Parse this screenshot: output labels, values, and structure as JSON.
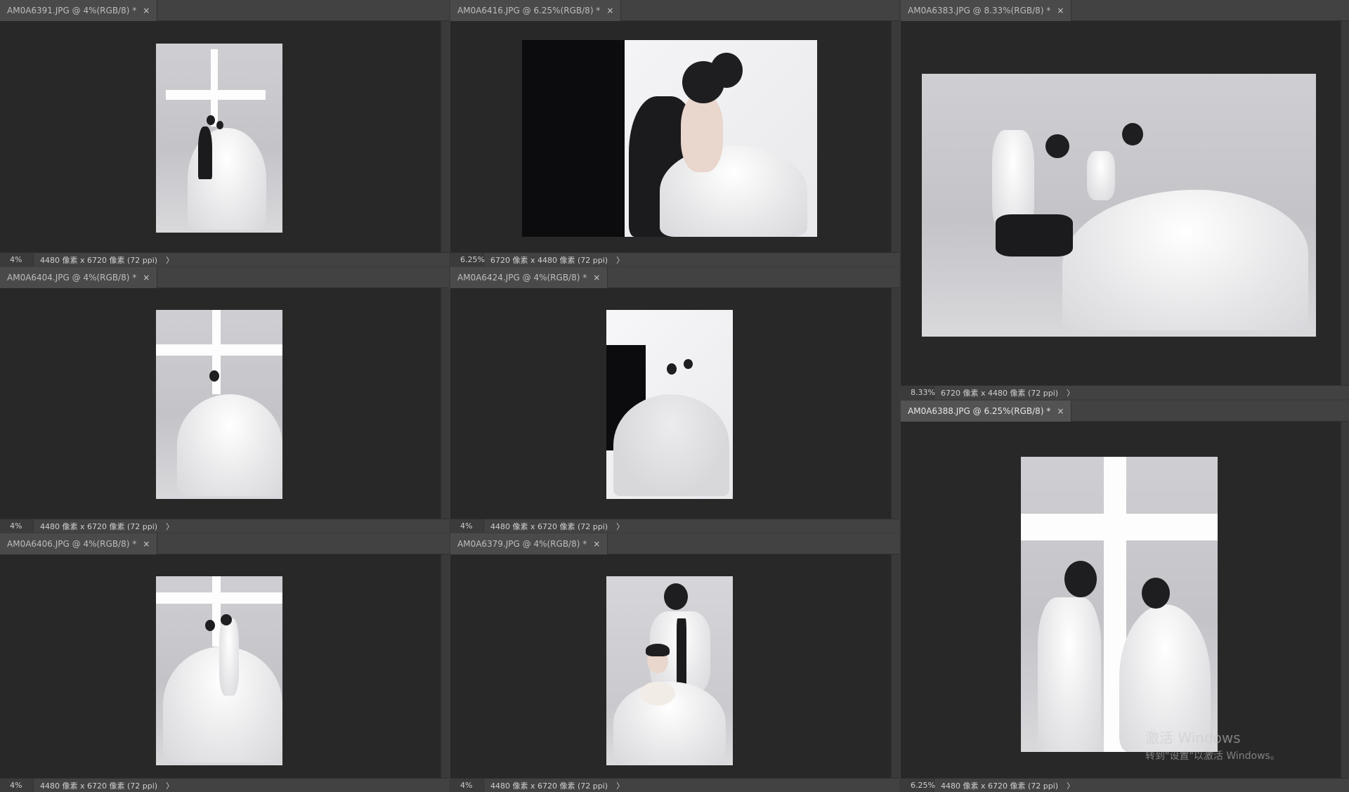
{
  "documents": [
    {
      "tab_label": "AM0A6391.JPG @ 4%(RGB/8) *",
      "zoom": "4%",
      "info": "4480 像素 x 6720 像素 (72 ppi)"
    },
    {
      "tab_label": "AM0A6416.JPG @ 6.25%(RGB/8) *",
      "zoom": "6.25%",
      "info": "6720 像素 x 4480 像素 (72 ppi)"
    },
    {
      "tab_label": "AM0A6383.JPG @ 8.33%(RGB/8) *",
      "zoom": "8.33%",
      "info": "6720 像素 x 4480 像素 (72 ppi)"
    },
    {
      "tab_label": "AM0A6404.JPG @ 4%(RGB/8) *",
      "zoom": "4%",
      "info": "4480 像素 x 6720 像素 (72 ppi)"
    },
    {
      "tab_label": "AM0A6424.JPG @ 4%(RGB/8) *",
      "zoom": "4%",
      "info": "4480 像素 x 6720 像素 (72 ppi)"
    },
    {
      "tab_label": "AM0A6388.JPG @ 6.25%(RGB/8) *",
      "zoom": "6.25%",
      "info": "4480 像素 x 6720 像素 (72 ppi)"
    },
    {
      "tab_label": "AM0A6406.JPG @ 4%(RGB/8) *",
      "zoom": "4%",
      "info": "4480 像素 x 6720 像素 (72 ppi)"
    },
    {
      "tab_label": "AM0A6379.JPG @ 4%(RGB/8) *",
      "zoom": "4%",
      "info": "4480 像素 x 6720 像素 (72 ppi)"
    }
  ],
  "icons": {
    "tab_close": "×",
    "status_arrow": "〉"
  },
  "watermark": {
    "line1": "激活 Windows",
    "line2": "转到\"设置\"以激活 Windows。"
  },
  "colors": {
    "canvas_bg": "#282828",
    "panel_bg": "#424242",
    "active_tab": "#535353"
  }
}
